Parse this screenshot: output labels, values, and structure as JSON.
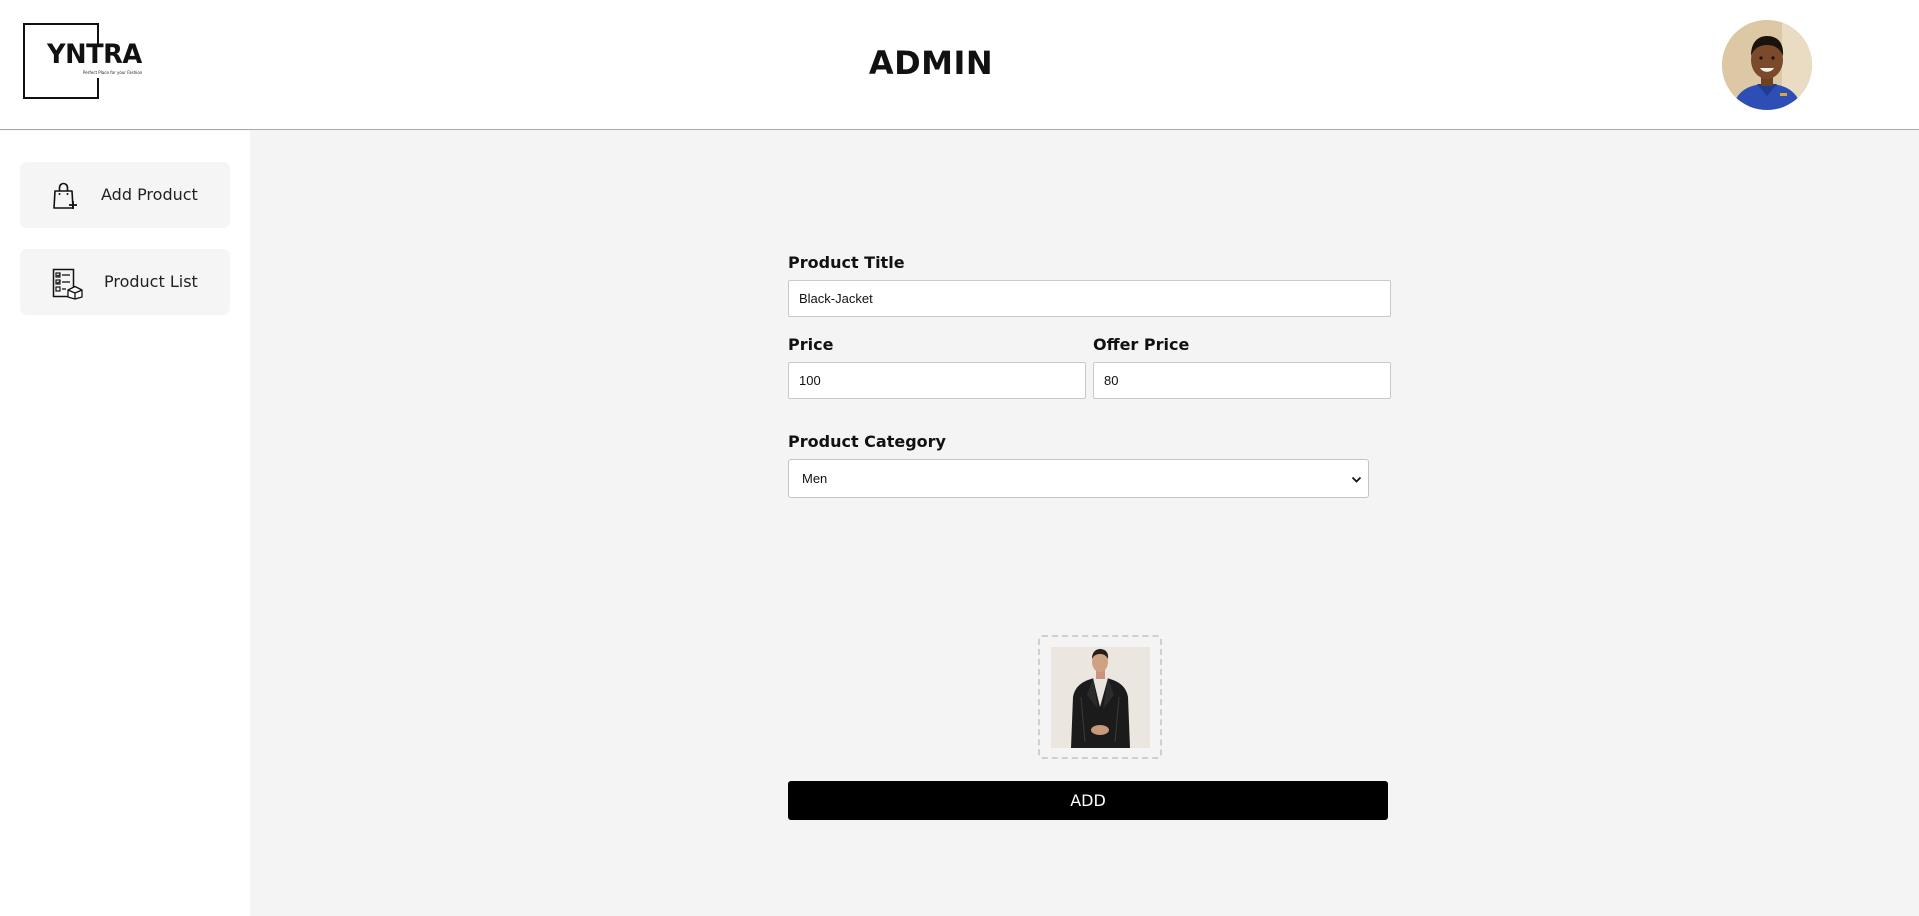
{
  "header": {
    "logo": {
      "brand": "YNTRA",
      "tagline": "Perfect Place for your Fashion"
    },
    "title": "ADMIN",
    "avatar_alt": "admin profile photo"
  },
  "sidebar": {
    "items": [
      {
        "label": "Add Product",
        "icon": "shopping-bag-plus-icon"
      },
      {
        "label": "Product List",
        "icon": "checklist-box-icon"
      }
    ]
  },
  "form": {
    "title_label": "Product Title",
    "title_value": "Black-Jacket",
    "price_label": "Price",
    "price_value": "100",
    "offer_label": "Offer Price",
    "offer_value": "80",
    "category_label": "Product Category",
    "category_value": "Men",
    "image_preview": "black leather jacket product photo",
    "submit_label": "ADD"
  },
  "colors": {
    "main_bg": "#f4f4f4",
    "sidebar_item_bg": "#f5f5f5",
    "button_bg": "#000000",
    "button_text": "#ffffff"
  }
}
